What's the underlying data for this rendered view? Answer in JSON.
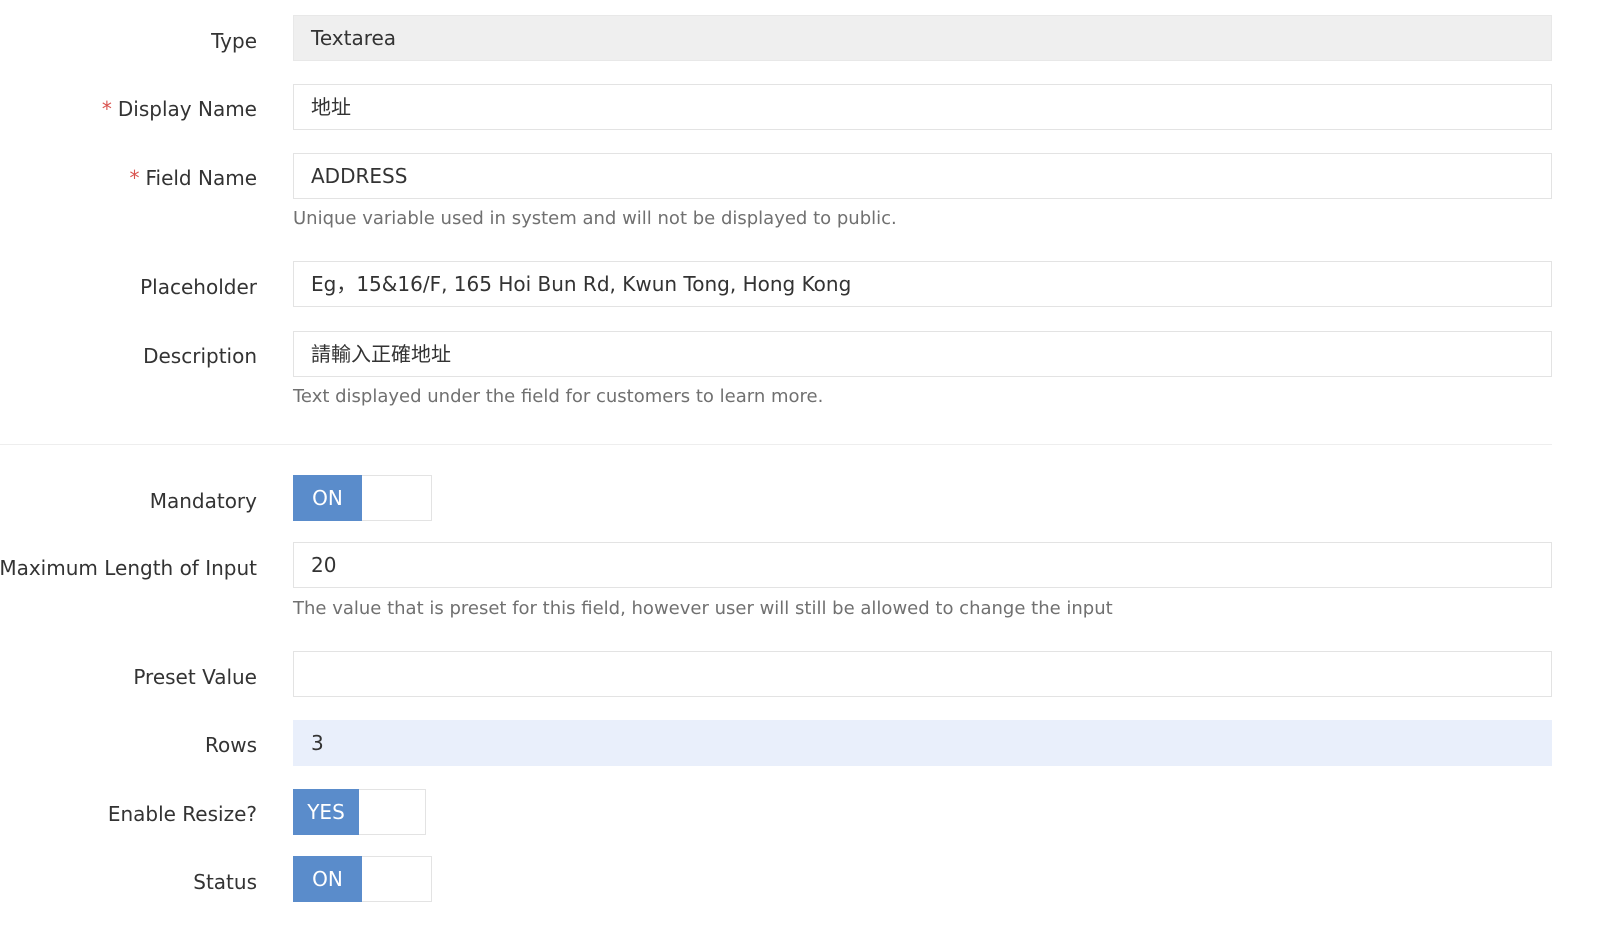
{
  "form": {
    "type": {
      "label": "Type",
      "value": "Textarea"
    },
    "display_name": {
      "required_mark": "*",
      "label": "Display Name",
      "value": "地址"
    },
    "field_name": {
      "required_mark": "*",
      "label": "Field Name",
      "value": "ADDRESS",
      "help": "Unique variable used in system and will not be displayed to public."
    },
    "placeholder": {
      "label": "Placeholder",
      "value": "Eg，15&16/F, 165 Hoi Bun Rd, Kwun Tong, Hong Kong"
    },
    "description": {
      "label": "Description",
      "value": "請輸入正確地址",
      "help": "Text displayed under the field for customers to learn more."
    },
    "mandatory": {
      "label": "Mandatory",
      "state": "ON",
      "enabled": true
    },
    "max_length": {
      "label": "Maximum Length of Input",
      "value": "20",
      "help": "The value that is preset for this field, however user will still be allowed to change the input"
    },
    "preset_value": {
      "label": "Preset Value",
      "value": ""
    },
    "rows": {
      "label": "Rows",
      "value": "3"
    },
    "enable_resize": {
      "label": "Enable Resize?",
      "state": "YES",
      "enabled": true
    },
    "status": {
      "label": "Status",
      "state": "ON",
      "enabled": true
    }
  },
  "colors": {
    "toggle_on": "#5a8ccb",
    "required_mark": "#d9534f",
    "readonly_bg": "#efefef",
    "focused_bg": "#e9effb",
    "help_text": "#707070"
  }
}
